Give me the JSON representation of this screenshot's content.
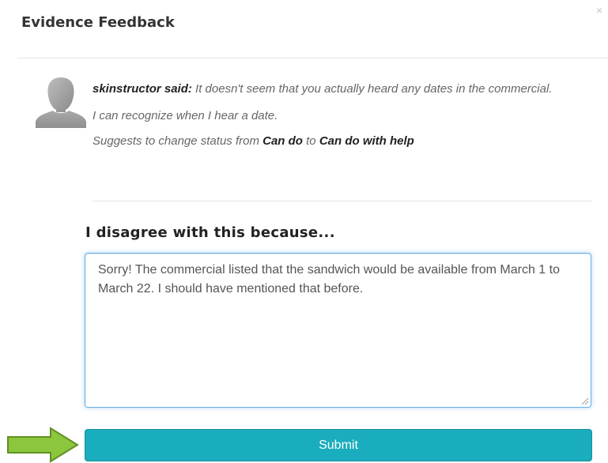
{
  "modal": {
    "title": "Evidence Feedback",
    "close_symbol": "×"
  },
  "feedback": {
    "avatar_icon": "user-silhouette-icon",
    "author": "skinstructor said:",
    "comment": "It doesn't seem that you actually heard any dates in the commercial.",
    "evidence_statement": "I can recognize when I hear a date.",
    "suggestion_prefix": "Suggests to change status from",
    "from_status": "Can do",
    "to_word": "to",
    "to_status": "Can do with help"
  },
  "response": {
    "heading": "I disagree with this because...",
    "text": "Sorry! The commercial listed that the sandwich would be available from March 1 to March 22. I should have mentioned that before.",
    "submit_label": "Submit"
  },
  "colors": {
    "submit_bg": "#1aadbd",
    "focus_border": "#66afe9",
    "arrow_fill": "#8cc63e",
    "arrow_stroke": "#5f8f22"
  },
  "annotation": {
    "arrow_icon": "green-arrow-right-icon"
  }
}
